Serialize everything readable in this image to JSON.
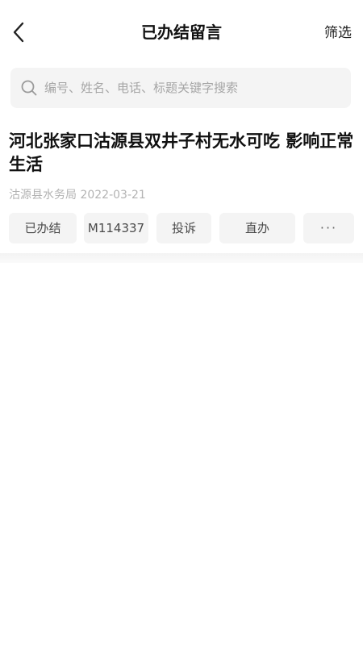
{
  "nav": {
    "title": "已办结留言",
    "filter_label": "筛选"
  },
  "search": {
    "placeholder": "编号、姓名、电话、标题关键字搜索",
    "value": ""
  },
  "message": {
    "title": "河北张家口沽源县双井子村无水可吃 影响正常生活",
    "department": "沽源县水务局",
    "date": "2022-03-21",
    "meta": "沽源县水务局 2022-03-21",
    "tags": {
      "status": "已办结",
      "id": "M114337",
      "type": "投诉",
      "handling": "直办",
      "more": "···"
    }
  },
  "icons": {
    "back": "chevron-left-icon",
    "search": "search-icon"
  },
  "colors": {
    "tag_background": "#f4f4f4",
    "meta_text": "#b3b3b3",
    "placeholder": "#a6a6a6"
  }
}
